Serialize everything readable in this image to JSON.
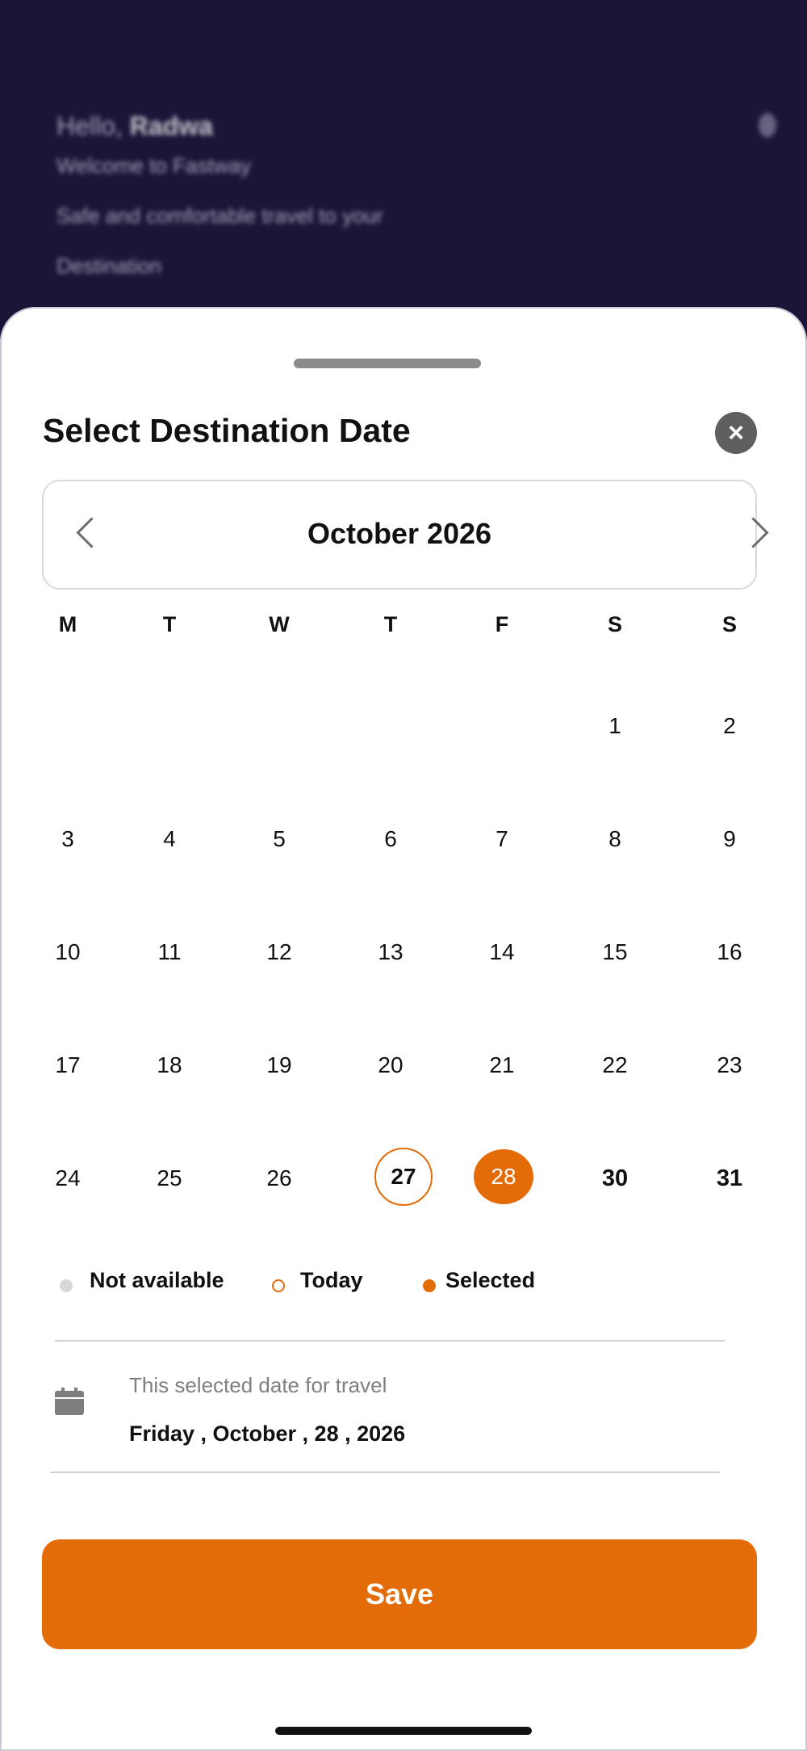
{
  "background": {
    "greeting_prefix": "Hello,",
    "greeting_name": "Radwa",
    "welcome": "Welcome to Fastway",
    "tagline_line1": "Safe and comfortable travel to your",
    "tagline_line2": "Destination"
  },
  "sheet": {
    "title": "Select Destination Date",
    "close_icon": "×",
    "month_label": "October 2026",
    "weekdays": [
      "M",
      "T",
      "W",
      "T",
      "F",
      "S",
      "S"
    ],
    "weeks": [
      [
        "",
        "",
        "",
        "",
        "",
        "1",
        "2"
      ],
      [
        "3",
        "4",
        "5",
        "6",
        "7",
        "8",
        "9"
      ],
      [
        "10",
        "11",
        "12",
        "13",
        "14",
        "15",
        "16"
      ],
      [
        "17",
        "18",
        "19",
        "20",
        "21",
        "22",
        "23"
      ],
      [
        "24",
        "25",
        "26",
        "27",
        "28",
        "30",
        "31"
      ]
    ],
    "today": "27",
    "selected": "28",
    "legend": {
      "not_available": "Not available",
      "today": "Today",
      "selected": "Selected"
    },
    "selected_caption": "This selected date for travel",
    "selected_date": "Friday , October ,  28 , 2026",
    "save_label": "Save"
  },
  "colors": {
    "accent": "#e36c09",
    "header_bg": "#1b1538",
    "not_available": "#d8d8d8"
  }
}
